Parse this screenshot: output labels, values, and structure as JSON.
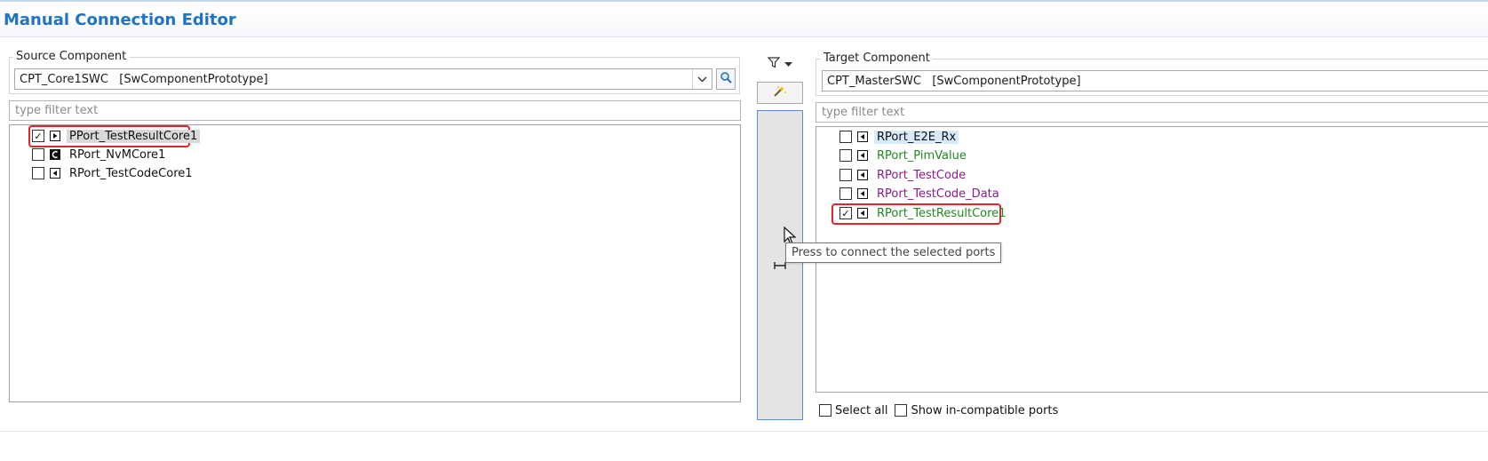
{
  "window": {
    "title": "Manual Connection Editor"
  },
  "source": {
    "group_label": "Source Component",
    "component_value": "CPT_Core1SWC   [SwComponentPrototype]",
    "filter_placeholder": "type filter text",
    "ports": [
      {
        "label": "PPort_TestResultCore1",
        "checked": true,
        "icon": "pport-icon",
        "color": "#111111"
      },
      {
        "label": "RPort_NvMCore1",
        "checked": false,
        "icon": "nvm-port-icon",
        "color": "#111111"
      },
      {
        "label": "RPort_TestCodeCore1",
        "checked": false,
        "icon": "rport-icon",
        "color": "#111111"
      }
    ]
  },
  "middle": {
    "filter_icon": "filter-icon",
    "wand_icon": "magic-wand-icon",
    "tooltip": "Press to connect the selected ports"
  },
  "target": {
    "group_label": "Target Component",
    "component_value": "CPT_MasterSWC   [SwComponentPrototype]",
    "filter_placeholder": "type filter text",
    "ports": [
      {
        "label": "RPort_E2E_Rx",
        "checked": false,
        "icon": "rport-icon",
        "color": "#111111"
      },
      {
        "label": "RPort_PimValue",
        "checked": false,
        "icon": "rport-icon",
        "color": "#1e8a1e"
      },
      {
        "label": "RPort_TestCode",
        "checked": false,
        "icon": "rport-icon",
        "color": "#8b1a8b"
      },
      {
        "label": "RPort_TestCode_Data",
        "checked": false,
        "icon": "rport-icon",
        "color": "#8b1a8b"
      },
      {
        "label": "RPort_TestResultCore1",
        "checked": true,
        "icon": "rport-icon",
        "color": "#1e8a1e"
      }
    ],
    "select_all_label": "Select all",
    "show_incompatible_label": "Show in-compatible ports"
  },
  "colors": {
    "title": "#1f73c4",
    "highlight": "#e0262b",
    "selected_bg": "#d9d9d9",
    "hover_bg": "#d6eaf8"
  }
}
